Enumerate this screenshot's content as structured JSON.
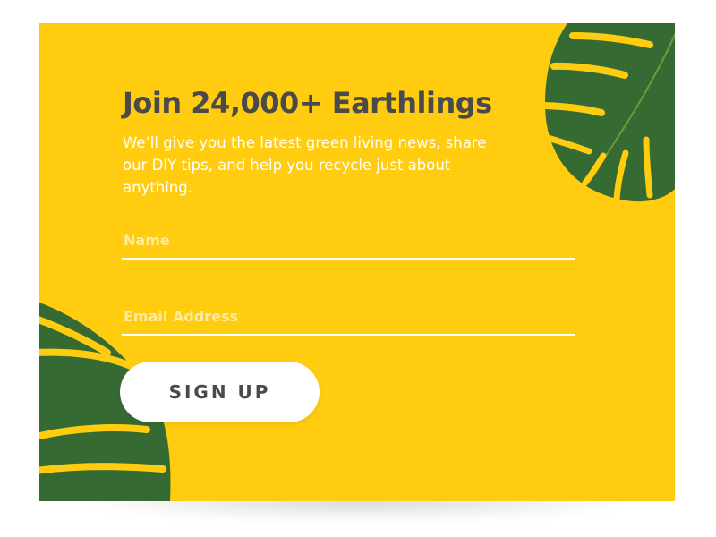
{
  "colors": {
    "background": "#FFCC0F",
    "leaf": "#356B33",
    "text": "#4A4A4A",
    "subtext": "#FFFFFF",
    "button_bg": "#FFFFFF",
    "button_text": "#4A4A4A"
  },
  "signup_card": {
    "headline": "Join 24,000+ Earthlings",
    "description": "We’ll give you the latest green living news, share our DIY tips, and help you recycle just about anything.",
    "name_input": {
      "placeholder": "Name",
      "value": ""
    },
    "email_input": {
      "placeholder": "Email Address",
      "value": ""
    },
    "submit_button": "SIGN UP"
  },
  "icons": [
    "monstera-leaf-top-right",
    "monstera-leaf-bottom-left"
  ]
}
